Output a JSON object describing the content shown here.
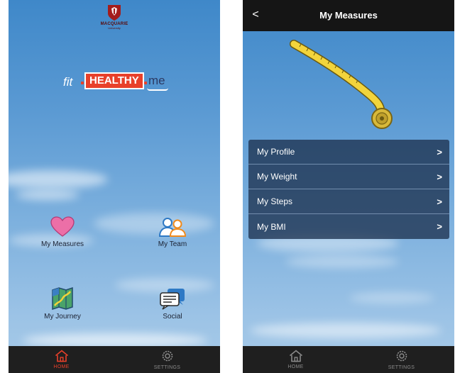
{
  "left_screen": {
    "logo": {
      "name": "MACQUARIE",
      "subtitle": "University"
    },
    "brand": {
      "part1": "fit",
      "part2": "HEALTHY",
      "part3": "me"
    },
    "tiles": [
      {
        "label": "My Measures",
        "icon": "heart-icon"
      },
      {
        "label": "My Team",
        "icon": "team-icon"
      },
      {
        "label": "My Journey",
        "icon": "map-icon"
      },
      {
        "label": "Social",
        "icon": "chat-icon"
      }
    ],
    "tabbar": [
      {
        "label": "HOME",
        "icon": "home-icon",
        "active": true
      },
      {
        "label": "SETTINGS",
        "icon": "gear-icon",
        "active": false
      }
    ]
  },
  "right_screen": {
    "navbar": {
      "back_label": "<",
      "title": "My Measures"
    },
    "illustration": "tape-measure-icon",
    "menu": [
      {
        "label": "My Profile"
      },
      {
        "label": "My Weight"
      },
      {
        "label": "My Steps"
      },
      {
        "label": "My BMI"
      }
    ],
    "tabbar": [
      {
        "label": "HOME",
        "icon": "home-icon",
        "active": false
      },
      {
        "label": "SETTINGS",
        "icon": "gear-icon",
        "active": false
      }
    ]
  },
  "colors": {
    "accent": "#e8402a",
    "tabbar_bg": "#1f1f1f",
    "navbar_bg": "#151515",
    "menu_bg": "#1e3250"
  }
}
